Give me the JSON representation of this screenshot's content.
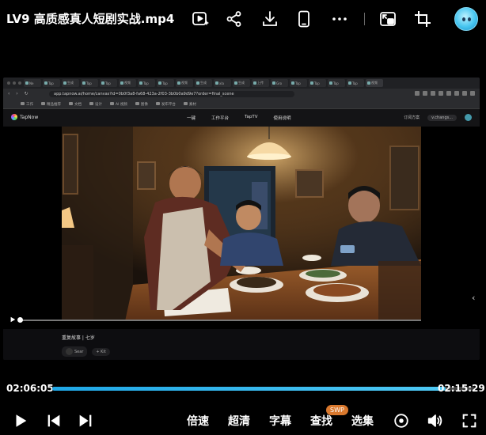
{
  "window": {
    "title": "LV9 高质感真人短剧实战.mp4"
  },
  "toolbar": {
    "icons": [
      "ai-play-icon",
      "share-icon",
      "download-icon",
      "phone-icon",
      "more-icon",
      "picture-in-picture-icon",
      "crop-icon",
      "avatar"
    ]
  },
  "browser": {
    "tabs": [
      "Ne",
      "Tap",
      "生成",
      "Tap",
      "Tap",
      "视频",
      "Tap",
      "Tap",
      "视频",
      "生成",
      "xla",
      "生成",
      "上传",
      "Gro",
      "Tap",
      "Tap",
      "Tap",
      "Tap",
      "视频"
    ],
    "url": "app.tapnow.ai/home/canvas?id=0b0f3a8-fa68-423a-2f03-3b0b0a9d9e7?order=final_scene",
    "bookmarks": [
      "工作",
      "精品推荐",
      "文档",
      "设计",
      "AI 视频",
      "图像",
      "发布平台",
      "素材"
    ]
  },
  "site": {
    "brand": "TapNow",
    "nav": [
      "一键",
      "工作平台",
      "TapTV",
      "使用说明"
    ],
    "right": [
      "订阅方案",
      "v.changs..."
    ]
  },
  "episode": {
    "title": "重复故事 | 七岁",
    "author": "Sear",
    "follow": "+ Kit"
  },
  "playback": {
    "current_time": "02:06:05",
    "total_time": "02:15:29",
    "progress": 0.93
  },
  "controls": {
    "speed": "倍速",
    "quality": "超清",
    "subtitle": "字幕",
    "search": "查找",
    "search_badge": "SWP",
    "episodes": "选集"
  },
  "colors": {
    "accent": "#2db3ee",
    "badge": "#d9782d"
  }
}
